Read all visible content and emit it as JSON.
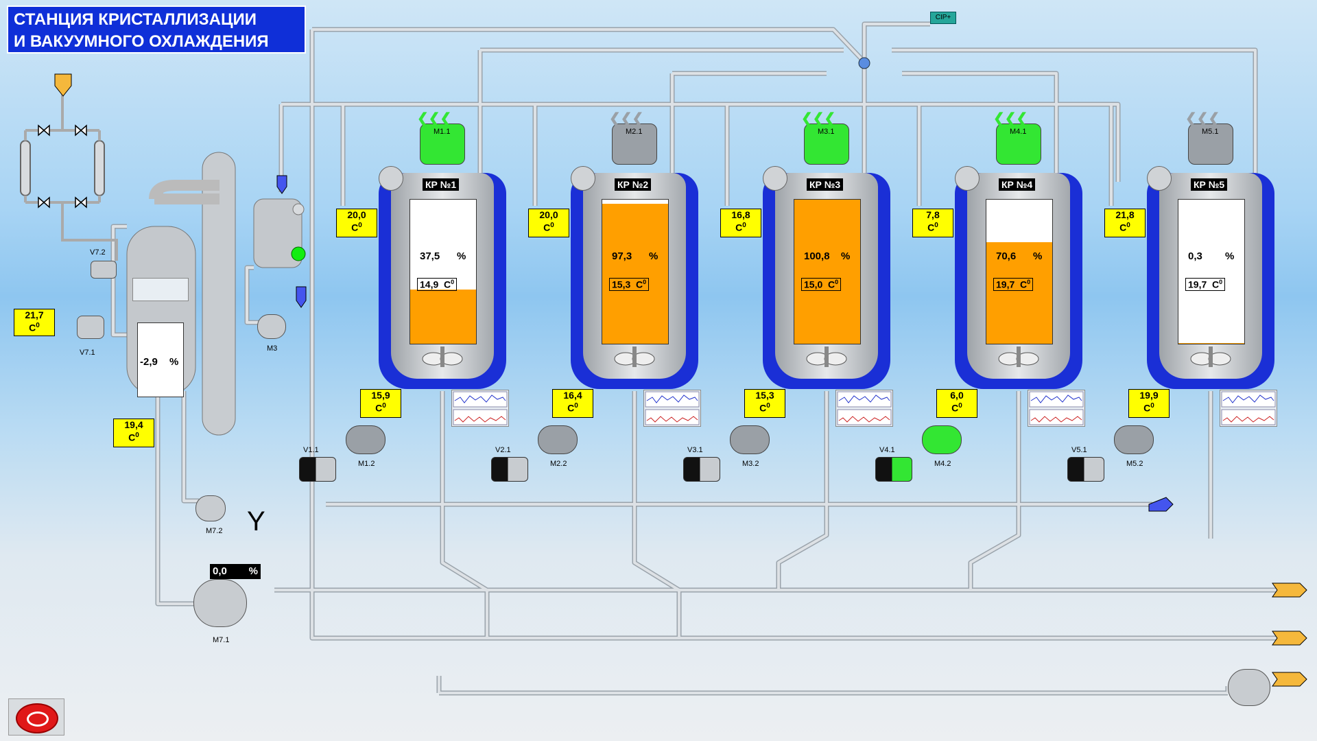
{
  "title": {
    "line1": "СТАНЦИЯ КРИСТАЛЛИЗАЦИИ",
    "line2": "И ВАКУУМНОГО ОХЛАЖДЕНИЯ"
  },
  "cip_label": "CIP+",
  "unit_label": "C",
  "unit_sup": "0",
  "pct_sign": "%",
  "vacuum": {
    "level_pct": "-2,9",
    "temp_left": "21,7",
    "temp_bottom": "19,4",
    "valves": [
      "V7.2",
      "V7.1"
    ],
    "pump_m3": "M3",
    "pump_m72": "M7.2",
    "pump_m71": "M7.1",
    "y_symbol": "Y",
    "m71_pct": "0,0"
  },
  "crystallizers": [
    {
      "name": "КР №1",
      "motor": "M1.1",
      "level": "37,5",
      "level_value": 37.5,
      "inner_temp": "14,9",
      "jacket_temp": "20,0",
      "bottom_temp": "15,9",
      "valve": "V1.1",
      "pump": "M1.2",
      "motor_state": "on",
      "pump_state": "off"
    },
    {
      "name": "КР №2",
      "motor": "M2.1",
      "level": "97,3",
      "level_value": 97.3,
      "inner_temp": "15,3",
      "jacket_temp": "20,0",
      "bottom_temp": "16,4",
      "valve": "V2.1",
      "pump": "M2.2",
      "motor_state": "off",
      "pump_state": "off"
    },
    {
      "name": "КР №3",
      "motor": "M3.1",
      "level": "100,8",
      "level_value": 100.8,
      "inner_temp": "15,0",
      "jacket_temp": "16,8",
      "bottom_temp": "15,3",
      "valve": "V3.1",
      "pump": "M3.2",
      "motor_state": "on",
      "pump_state": "off"
    },
    {
      "name": "КР №4",
      "motor": "M4.1",
      "level": "70,6",
      "level_value": 70.6,
      "inner_temp": "19,7",
      "jacket_temp": "7,8",
      "bottom_temp": "6,0",
      "valve": "V4.1",
      "pump": "M4.2",
      "motor_state": "on",
      "pump_state": "on"
    },
    {
      "name": "КР №5",
      "motor": "M5.1",
      "level": "0,3",
      "level_value": 0.3,
      "inner_temp": "19,7",
      "jacket_temp": "21,8",
      "bottom_temp": "19,9",
      "valve": "V5.1",
      "pump": "M5.2",
      "motor_state": "off",
      "pump_state": "off"
    }
  ],
  "colors": {
    "product": "#ff9f00",
    "jacket": "#1a2fd6",
    "running": "#33e633",
    "stopped": "#9aa0a6",
    "pipe": "#d4d8dc",
    "tempbox": "#ffff00"
  }
}
